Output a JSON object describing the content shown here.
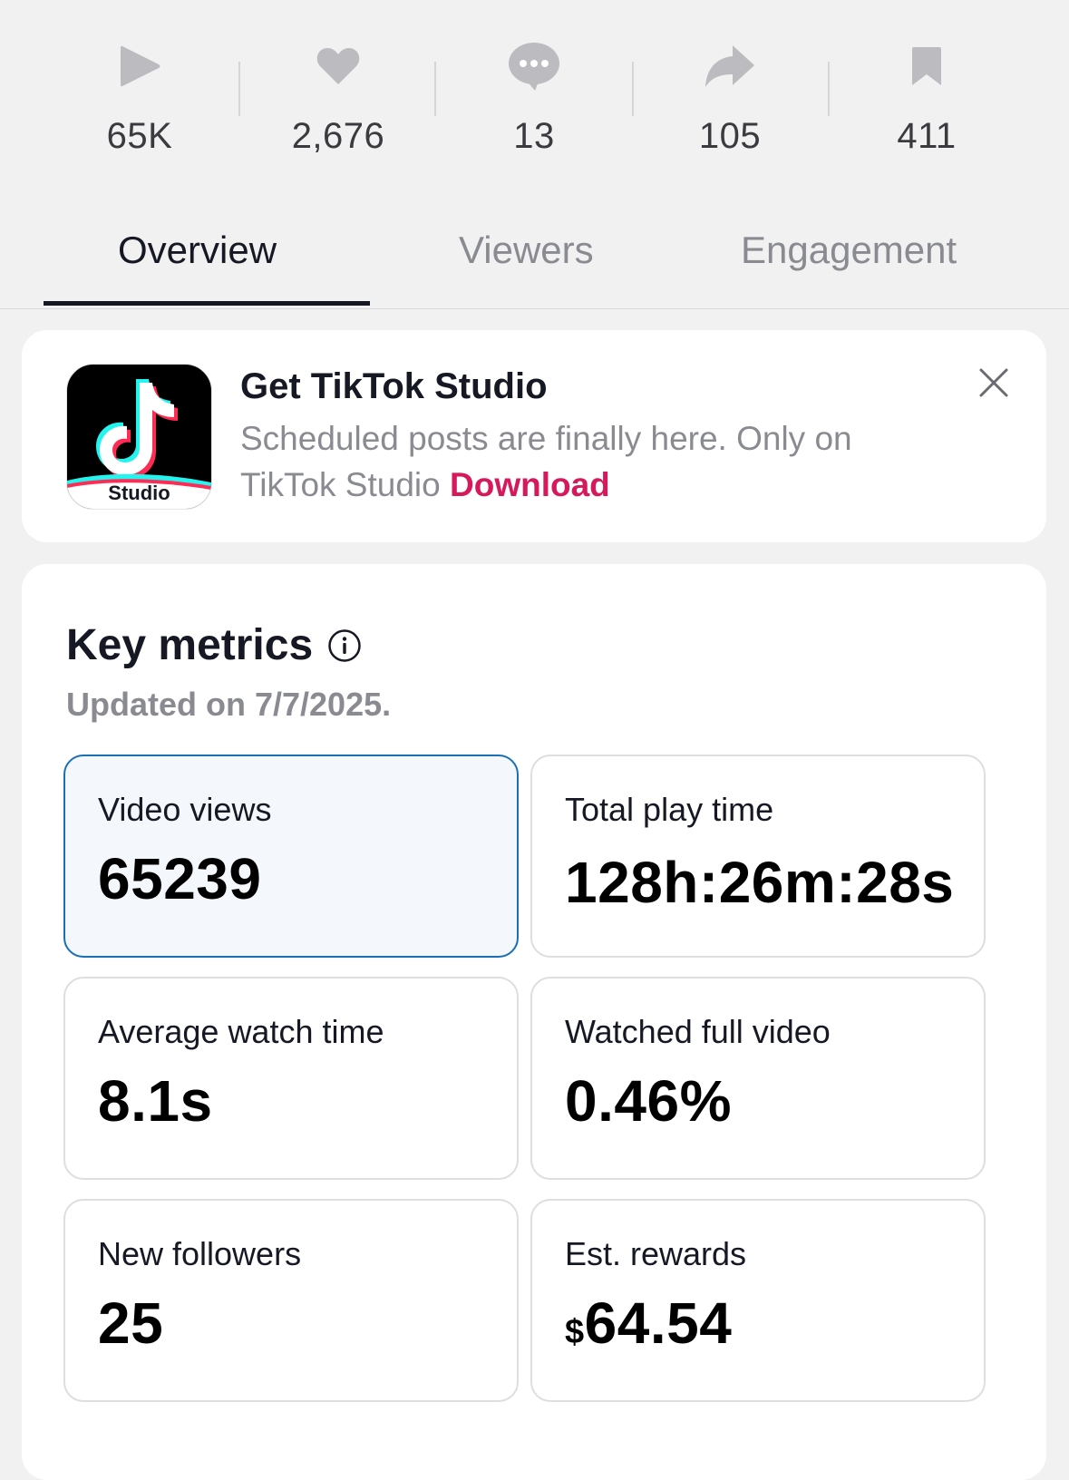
{
  "stats": [
    {
      "icon": "play-icon",
      "count": "65K"
    },
    {
      "icon": "heart-icon",
      "count": "2,676"
    },
    {
      "icon": "comment-icon",
      "count": "13"
    },
    {
      "icon": "share-icon",
      "count": "105"
    },
    {
      "icon": "bookmark-icon",
      "count": "411"
    }
  ],
  "tabs": [
    {
      "label": "Overview",
      "active": true
    },
    {
      "label": "Viewers",
      "active": false
    },
    {
      "label": "Engagement",
      "active": false
    }
  ],
  "promo": {
    "icon_caption": "Studio",
    "title": "Get TikTok Studio",
    "description": "Scheduled posts are finally here. Only on TikTok Studio",
    "link_label": "Download",
    "link_color": "#d6195a"
  },
  "metrics": {
    "title": "Key metrics",
    "updated": "Updated on 7/7/2025.",
    "cards": [
      {
        "label": "Video views",
        "value": "65239",
        "selected": true
      },
      {
        "label": "Total play time",
        "value": "128h:26m:28s"
      },
      {
        "label": "Average watch time",
        "value": "8.1s"
      },
      {
        "label": "Watched full video",
        "value": "0.46%"
      },
      {
        "label": "New followers",
        "value": "25"
      },
      {
        "label": "Est. rewards",
        "currency": "$",
        "value": "64.54"
      }
    ]
  },
  "colors": {
    "selected_border": "#1a6fb5",
    "selected_bg": "#f4f8fd",
    "tiktok_cyan": "#25f4ee",
    "tiktok_red": "#fe2c55"
  }
}
